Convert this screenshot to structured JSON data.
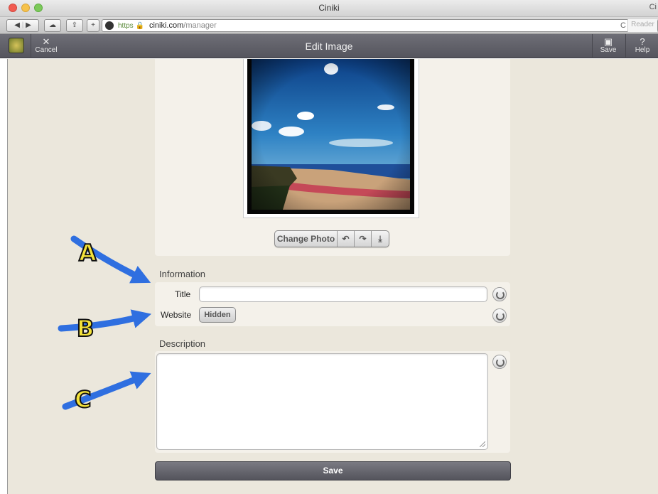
{
  "browser": {
    "window_title": "Ciniki",
    "window_right_text": "Ci",
    "url_scheme": "https",
    "url_host": "ciniki.com",
    "url_path": "/manager",
    "reload_glyph": "C",
    "reader_label": "Reader"
  },
  "app_header": {
    "cancel_label": "Cancel",
    "title": "Edit Image",
    "save_label": "Save",
    "help_label": "Help"
  },
  "photo_tools": {
    "change_photo_label": "Change Photo",
    "rotate_left_glyph": "↶",
    "rotate_right_glyph": "↷",
    "download_glyph": "⤓"
  },
  "information": {
    "section_label": "Information",
    "title_label": "Title",
    "title_value": "",
    "website_label": "Website",
    "website_button": "Hidden"
  },
  "description": {
    "section_label": "Description",
    "value": ""
  },
  "save_button_label": "Save",
  "annotations": {
    "a": "A",
    "b": "B",
    "c": "C",
    "arrow_color": "#2f6fe0"
  },
  "colors": {
    "header_bg": "#5f5f68",
    "page_bg": "#ebe7dc"
  }
}
